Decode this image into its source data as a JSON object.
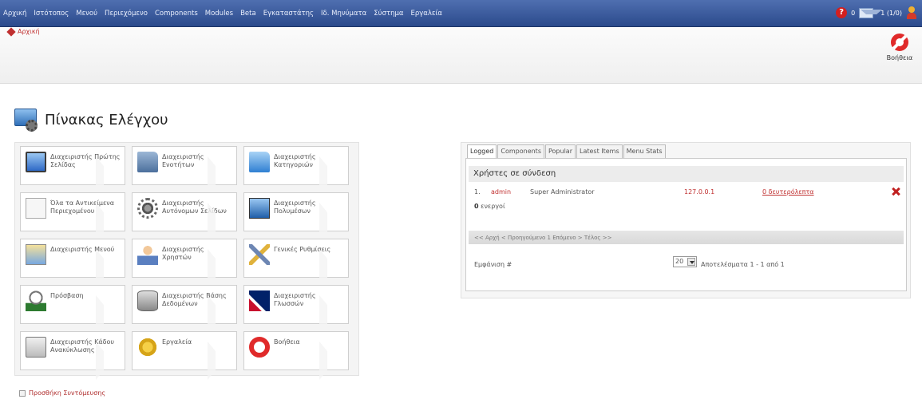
{
  "top_menu": {
    "items": [
      "Αρχική",
      "Ιστότοπος",
      "Μενού",
      "Περιεχόμενο",
      "Components",
      "Modules",
      "Beta",
      "Εγκαταστάτης",
      "Ιδ. Μηνύματα",
      "Σύστημα",
      "Εργαλεία"
    ],
    "messages_count": "0",
    "users_online": "1 (1/0)"
  },
  "breadcrumb": {
    "label": "Αρχική"
  },
  "help_button": {
    "label": "Βοήθεια"
  },
  "page_title": "Πίνακας Ελέγχου",
  "icon_grid": [
    {
      "label": "Διαχειριστής Πρώτης Σελίδας",
      "icon": "monitor-icon"
    },
    {
      "label": "Διαχειριστής Ενοτήτων",
      "icon": "folder-icon"
    },
    {
      "label": "Διαχειριστής Κατηγοριών",
      "icon": "folder-open-icon"
    },
    {
      "label": "Όλα τα Αντικείμενα Περιεχομένου",
      "icon": "document-icon"
    },
    {
      "label": "Διαχειριστής Αυτόνομων Σελίδων",
      "icon": "gear-icon"
    },
    {
      "label": "Διαχειριστής Πολυμέσων",
      "icon": "media-icon"
    },
    {
      "label": "Διαχειριστής Μενού",
      "icon": "menu-icon"
    },
    {
      "label": "Διαχειριστής Χρηστών",
      "icon": "user-icon"
    },
    {
      "label": "Γενικές Ρυθμίσεις",
      "icon": "tools-icon"
    },
    {
      "label": "Πρόσβαση",
      "icon": "access-icon"
    },
    {
      "label": "Διαχειριστής Βάσης Δεδομένων",
      "icon": "database-icon"
    },
    {
      "label": "Διαχειριστής Γλωσσών",
      "icon": "flag-icon"
    },
    {
      "label": "Διαχειριστής Κάδου Ανακύκλωσης",
      "icon": "trash-icon"
    },
    {
      "label": "Εργαλεία",
      "icon": "wrench-icon"
    },
    {
      "label": "Βοήθεια",
      "icon": "lifebuoy-icon"
    }
  ],
  "add_shortcut": "Προσθήκη Συντόμευσης",
  "tabs": [
    "Logged",
    "Components",
    "Popular",
    "Latest Items",
    "Menu Stats"
  ],
  "logged": {
    "title": "Χρήστες σε σύνδεση",
    "row": {
      "num": "1.",
      "user": "admin",
      "group": "Super Administrator",
      "ip": "127.0.0.1",
      "time": "0 δευτερόλεπτα"
    },
    "active_count": "0",
    "active_label": "ενεργοί",
    "pager": "<< Αρχή < Προηγούμενο 1 Επόμενο > Τέλος >>",
    "display_label": "Εμφάνιση #",
    "page_size": "20",
    "results": "Αποτελέσματα 1 - 1 από 1"
  },
  "colors": {
    "topbar": "#2b4a8c",
    "link": "#c03030",
    "accent_red": "#e02a2a"
  }
}
